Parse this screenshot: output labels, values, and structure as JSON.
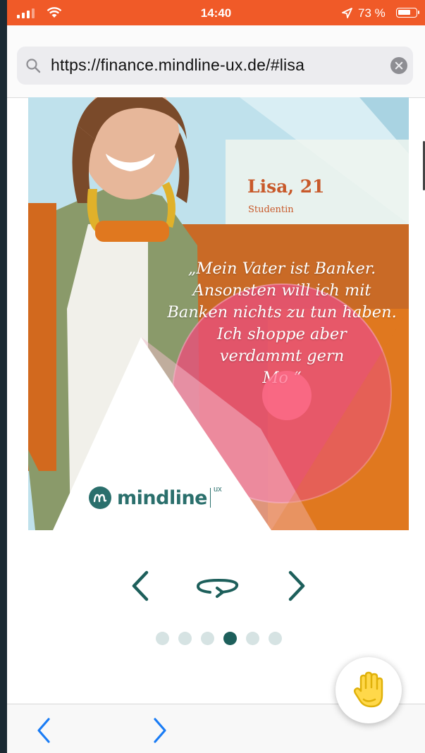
{
  "status_bar": {
    "time": "14:40",
    "battery_percent": "73 %",
    "battery_level": 0.73,
    "accent_color": "#f05a28"
  },
  "url_bar": {
    "url": "https://finance.mindline-ux.de/#lisa",
    "search_icon": "search-icon",
    "clear_icon": "clear-icon"
  },
  "card": {
    "name": "Lisa, 21",
    "role": "Studentin",
    "quote_lines": [
      "„Mein Vater ist Banker.",
      "Ansonsten will ich mit",
      "Banken nichts zu tun haben.",
      "Ich shoppe aber",
      "verdammt gern",
      "Mo    “"
    ],
    "brand": "mindline",
    "brand_suffix": "ux",
    "colors": {
      "orange": "#d2691e",
      "teal": "#2a6f6c",
      "pink": "#e8507a"
    }
  },
  "carousel": {
    "prev_icon": "chevron-left-icon",
    "rotate_icon": "rotate-icon",
    "next_icon": "chevron-right-icon",
    "slide_count": 6,
    "active_index": 3
  },
  "floating_button": {
    "icon": "hand-icon"
  },
  "toolbar": {
    "back_icon": "back-icon",
    "forward_icon": "forward-icon"
  }
}
